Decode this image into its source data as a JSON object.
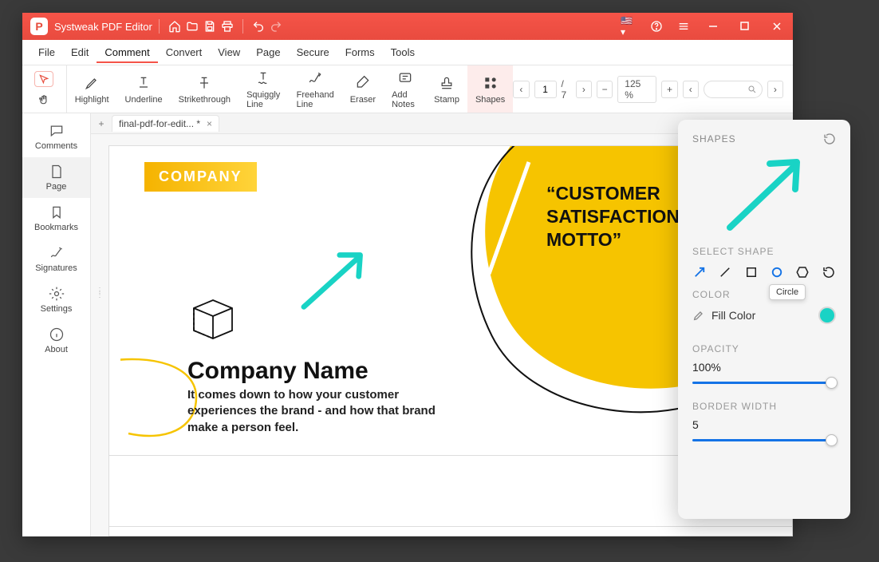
{
  "titlebar": {
    "app_name": "Systweak PDF Editor"
  },
  "menubar": [
    "File",
    "Edit",
    "Comment",
    "Convert",
    "View",
    "Page",
    "Secure",
    "Forms",
    "Tools"
  ],
  "menubar_active_index": 2,
  "sidebar": [
    {
      "label": "Comments",
      "icon": "comment"
    },
    {
      "label": "Page",
      "icon": "page"
    },
    {
      "label": "Bookmarks",
      "icon": "bookmark"
    },
    {
      "label": "Signatures",
      "icon": "signature"
    },
    {
      "label": "Settings",
      "icon": "settings"
    },
    {
      "label": "About",
      "icon": "info"
    }
  ],
  "sidebar_active_index": 1,
  "tools": [
    {
      "label": "Highlight",
      "icon": "highlight"
    },
    {
      "label": "Underline",
      "icon": "underline"
    },
    {
      "label": "Strikethrough",
      "icon": "strike"
    },
    {
      "label": "Squiggly Line",
      "icon": "squiggly"
    },
    {
      "label": "Freehand Line",
      "icon": "freehand"
    },
    {
      "label": "Eraser",
      "icon": "eraser"
    },
    {
      "label": "Add Notes",
      "icon": "notes"
    },
    {
      "label": "Stamp",
      "icon": "stamp"
    },
    {
      "label": "Shapes",
      "icon": "shapes"
    }
  ],
  "tools_active_index": 8,
  "page_nav": {
    "current": "1",
    "total": "7",
    "zoom": "125 %"
  },
  "tab": {
    "title": "final-pdf-for-edit... *"
  },
  "document": {
    "chip": "COMPANY",
    "heading": "Company Name",
    "body": "It comes down to how your customer experiences the brand - and how that brand make a person feel.",
    "motto": "“CUSTOMER SATISFACTION IS OUR MOTTO”"
  },
  "shapes_panel": {
    "title": "SHAPES",
    "select_label": "SELECT SHAPE",
    "shapes": [
      "arrow",
      "line",
      "square",
      "circle",
      "hexagon",
      "rotate"
    ],
    "selected_shape_index": 3,
    "tooltip": "Circle",
    "color_label": "COLOR",
    "fill_label": "Fill Color",
    "fill_color": "#19d3c5",
    "opacity_label": "OPACITY",
    "opacity_value": "100%",
    "border_label": "BORDER WIDTH",
    "border_value": "5"
  },
  "colors": {
    "accent": "#f55448",
    "teal": "#19d3c5",
    "blue": "#1473e6",
    "yellow": "#f6c400"
  }
}
